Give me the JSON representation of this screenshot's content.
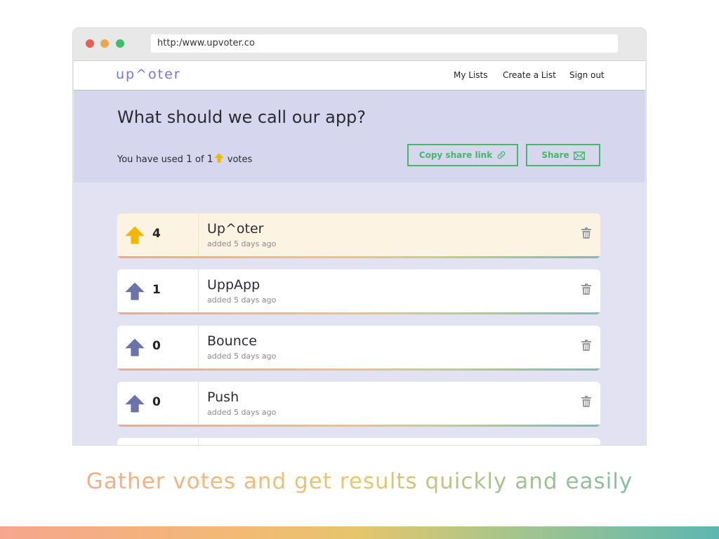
{
  "browser": {
    "url": "http:/www.upvoter.co"
  },
  "nav": {
    "logo": "up^oter",
    "links": [
      "My Lists",
      "Create a List",
      "Sign out"
    ]
  },
  "hero": {
    "title": "What should we call our app?",
    "votes_prefix": "You have used",
    "votes_used": "1",
    "votes_of": "of",
    "votes_total": "1",
    "votes_suffix": "votes",
    "copy_link_label": "Copy share link",
    "share_label": "Share"
  },
  "items": [
    {
      "name": "Up^oter",
      "meta": "added 5 days ago",
      "count": "4",
      "voted": true
    },
    {
      "name": "UppApp",
      "meta": "added 5 days ago",
      "count": "1",
      "voted": false
    },
    {
      "name": "Bounce",
      "meta": "added 5 days ago",
      "count": "0",
      "voted": false
    },
    {
      "name": "Push",
      "meta": "added 5 days ago",
      "count": "0",
      "voted": false
    }
  ],
  "tagline": "Gather votes and get results quickly and easily",
  "colors": {
    "brand": "#6e78e8",
    "accent_green": "#44b865",
    "voted_arrow": "#f2b705",
    "unvoted_arrow": "#6b73a8"
  },
  "icons": {
    "upvote": "upvote-arrow-icon",
    "link": "link-icon",
    "mail": "mail-icon",
    "trash": "trash-icon"
  }
}
